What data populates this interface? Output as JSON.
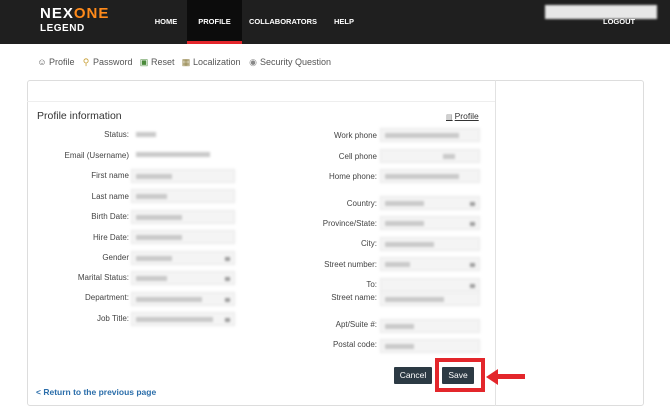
{
  "brand": {
    "line1_a": "NEX",
    "line1_b": "ONE",
    "line2": "LEGEND",
    "accent_color": "#ff8a1a"
  },
  "nav": {
    "items": [
      "HOME",
      "PROFILE",
      "COLLABORATORS",
      "HELP"
    ],
    "active": "PROFILE",
    "logout": "LOGOUT"
  },
  "subnav": [
    {
      "label": "Profile",
      "icon": "profile-icon"
    },
    {
      "label": "Password",
      "icon": "key-icon"
    },
    {
      "label": "Reset",
      "icon": "reset-icon"
    },
    {
      "label": "Localization",
      "icon": "localization-icon"
    },
    {
      "label": "Security Question",
      "icon": "security-question-icon"
    }
  ],
  "section": {
    "title": "Profile information",
    "profile_link": "Profile"
  },
  "form": {
    "left_labels": {
      "status": "Status:",
      "email": "Email (Username)",
      "first_name": "First name",
      "last_name": "Last name",
      "birth_date": "Birth Date:",
      "hire_date": "Hire Date:",
      "gender": "Gender",
      "marital_status": "Marital Status:",
      "department": "Department:",
      "job_title": "Job Title:"
    },
    "right_labels": {
      "work_phone": "Work phone",
      "cell_phone": "Cell phone",
      "home_phone": "Home phone:",
      "country": "Country:",
      "province_state": "Province/State:",
      "city": "City:",
      "street_number": "Street number:",
      "to": "To:",
      "street_name": "Street name:",
      "apt_suite": "Apt/Suite #:",
      "postal_code": "Postal code:"
    }
  },
  "actions": {
    "cancel": "Cancel",
    "save": "Save"
  },
  "back_link": "< Return to the previous page",
  "highlight_color": "#e3262b"
}
